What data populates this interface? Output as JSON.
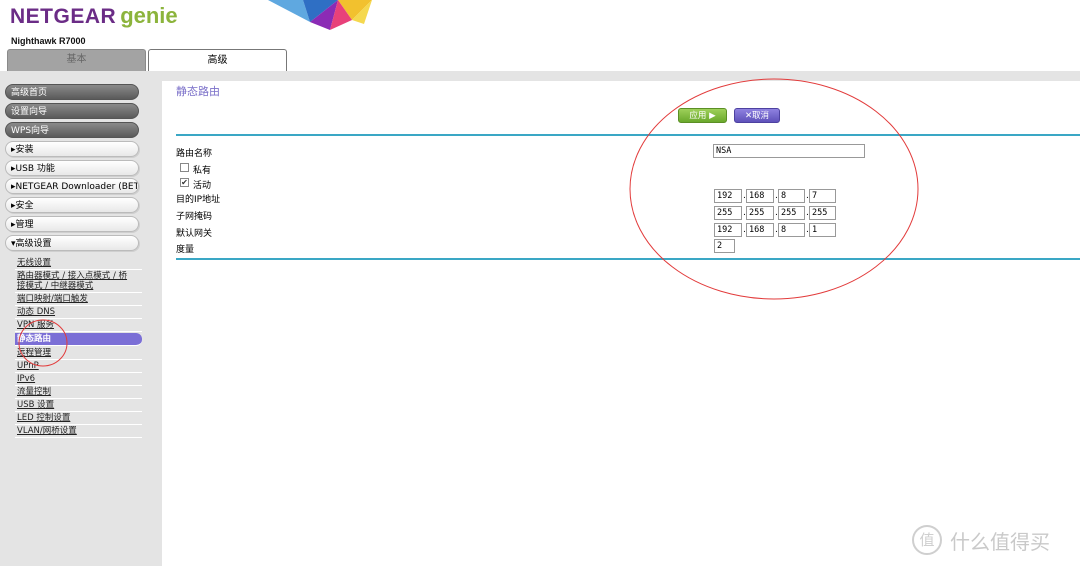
{
  "header": {
    "brand": "NETGEAR",
    "product": "genie",
    "model": "Nighthawk R7000",
    "tabs": {
      "basic": "基本",
      "advanced": "高级"
    }
  },
  "sidebar": {
    "buttons": [
      "高级首页",
      "设置向导",
      "WPS向导",
      "▸安装",
      "▸USB 功能",
      "▸NETGEAR Downloader (BETA)",
      "▸安全",
      "▸管理",
      "▾高级设置"
    ],
    "submenu": [
      "无线设置",
      "路由器模式 / 接入点模式 / 桥",
      "接模式 / 中继器模式",
      "端口映射/端口触发",
      "动态 DNS",
      "VPN 服务",
      "静态路由",
      "远程管理",
      "UPnP",
      "IPv6",
      "流量控制",
      "USB 设置",
      "LED 控制设置",
      "VLAN/网桥设置"
    ]
  },
  "main": {
    "title": "静态路由",
    "apply_label": "应用 ▶",
    "cancel_label": "✕取消",
    "form": {
      "route_name_label": "路由名称",
      "route_name_value": "NSA",
      "private_label": "私有",
      "private_checked": false,
      "active_label": "活动",
      "active_checked": true,
      "dest_ip_label": "目的IP地址",
      "dest_ip": [
        "192",
        "168",
        "8",
        "7"
      ],
      "subnet_label": "子网掩码",
      "subnet": [
        "255",
        "255",
        "255",
        "255"
      ],
      "gateway_label": "默认网关",
      "gateway": [
        "192",
        "168",
        "8",
        "1"
      ],
      "metric_label": "度量",
      "metric_value": "2"
    }
  },
  "watermark": "什么值得买",
  "colors": {
    "brand_purple": "#6b2c86",
    "genie_green": "#8cb43c",
    "accent_purple": "#7b6fd6",
    "rule_blue": "#3aa7c5",
    "apply_green": "#6aa82c",
    "annotation_red": "#e23b3b"
  }
}
